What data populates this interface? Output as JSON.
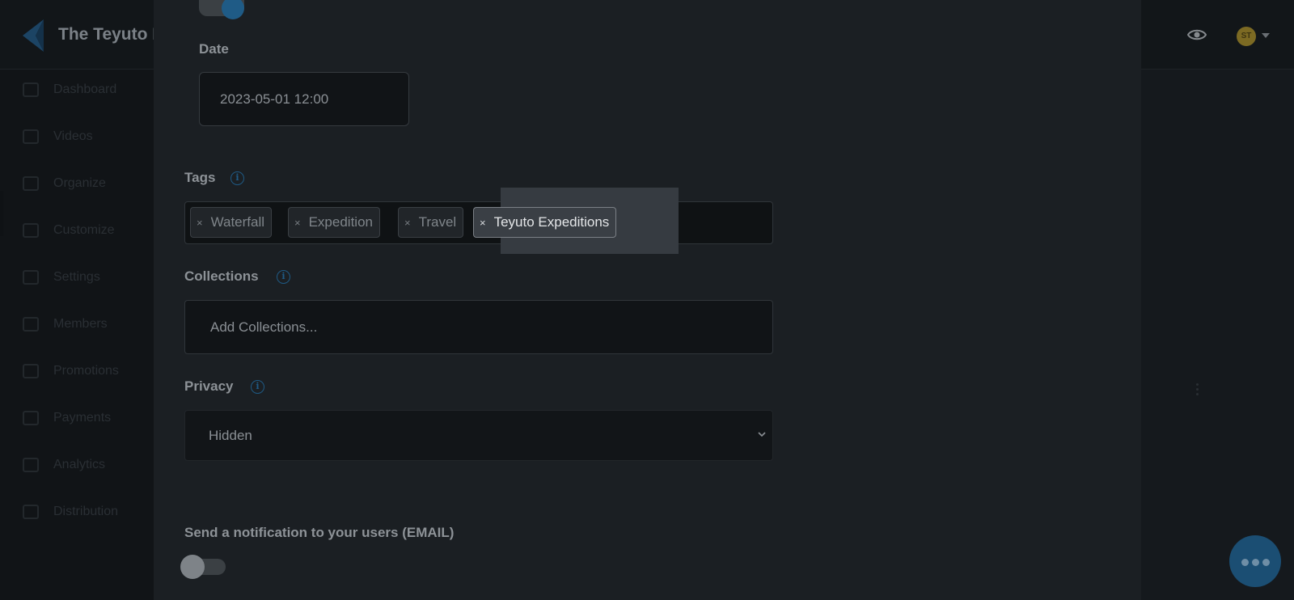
{
  "app": {
    "title": "The Teyuto I",
    "avatar_initials": "ST"
  },
  "sidebar": {
    "items": [
      {
        "label": "Dashboard",
        "icon": "home-icon"
      },
      {
        "label": "Videos",
        "icon": "video-icon"
      },
      {
        "label": "Organize",
        "icon": "organize-icon"
      },
      {
        "label": "Customize",
        "icon": "brush-icon"
      },
      {
        "label": "Settings",
        "icon": "settings-icon"
      },
      {
        "label": "Members",
        "icon": "members-icon"
      },
      {
        "label": "Promotions",
        "icon": "calendar-icon"
      },
      {
        "label": "Payments",
        "icon": "card-icon"
      },
      {
        "label": "Analytics",
        "icon": "analytics-icon"
      },
      {
        "label": "Distribution",
        "icon": "distribution-icon"
      }
    ]
  },
  "form": {
    "date": {
      "label": "Date",
      "value": "2023-05-01 12:00"
    },
    "tags": {
      "label": "Tags",
      "items": [
        "Waterfall",
        "Expedition",
        "Travel",
        "Teyuto Expeditions"
      ],
      "remove_glyph": "×"
    },
    "collections": {
      "label": "Collections",
      "placeholder": "Add Collections..."
    },
    "privacy": {
      "label": "Privacy",
      "value": "Hidden"
    },
    "notification": {
      "label": "Send a notification to your users (EMAIL)",
      "enabled": false
    },
    "top_toggle_enabled": true,
    "info_glyph": "i"
  },
  "colors": {
    "accent": "#1f5b86",
    "modal_bg": "#1b1f23",
    "overlay_bg": "#15191d"
  }
}
